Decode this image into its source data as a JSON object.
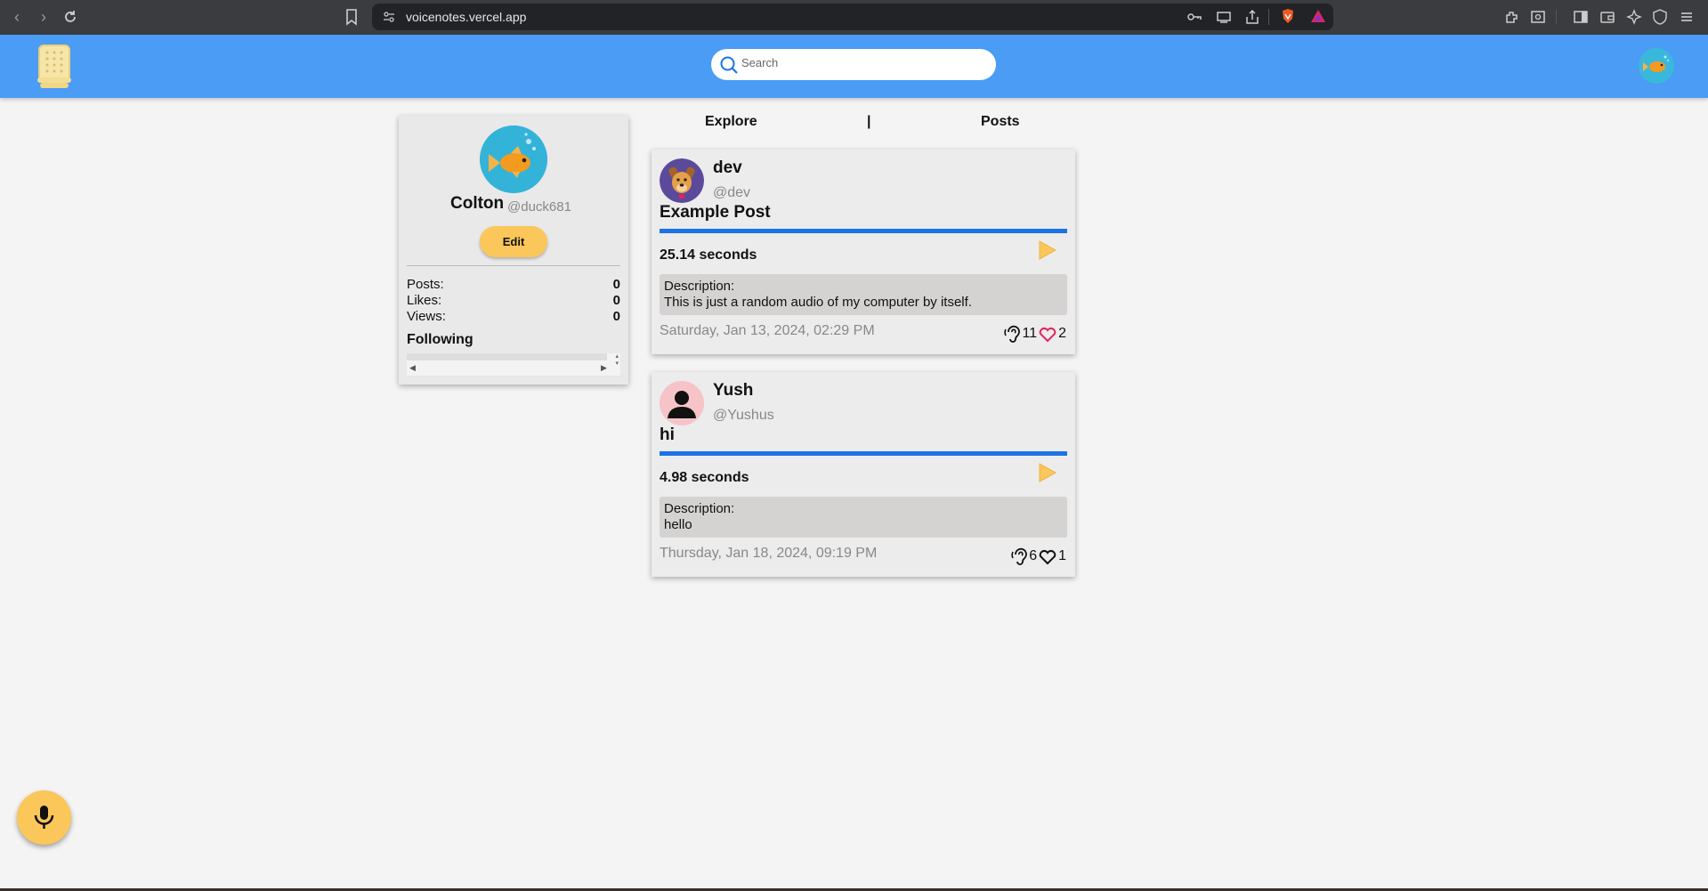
{
  "browser": {
    "url": "voicenotes.vercel.app"
  },
  "header": {
    "search_placeholder": "Search"
  },
  "profile": {
    "name": "Colton",
    "handle": "@duck681",
    "edit_label": "Edit",
    "stats": [
      {
        "label": "Posts:",
        "value": "0"
      },
      {
        "label": "Likes:",
        "value": "0"
      },
      {
        "label": "Views:",
        "value": "0"
      }
    ],
    "following_label": "Following"
  },
  "tabs": {
    "explore": "Explore",
    "separator": "|",
    "posts": "Posts"
  },
  "posts": [
    {
      "name": "dev",
      "handle": "@dev",
      "title": "Example Post",
      "duration": "25.14 seconds",
      "description_label": "Description:",
      "description": "This is just a random audio of my computer by itself.",
      "date": "Saturday, Jan 13, 2024, 02:29 PM",
      "listens": "11",
      "likes": "2",
      "liked": true
    },
    {
      "name": "Yush",
      "handle": "@Yushus",
      "title": "hi",
      "duration": "4.98 seconds",
      "description_label": "Description:",
      "description": "hello",
      "date": "Thursday, Jan 18, 2024, 09:19 PM",
      "listens": "6",
      "likes": "1",
      "liked": false
    }
  ],
  "colors": {
    "header": "#4a9cf5",
    "accent_yellow": "#fbc65a",
    "progress_blue": "#1a73e8",
    "like_pink": "#e0245e"
  }
}
